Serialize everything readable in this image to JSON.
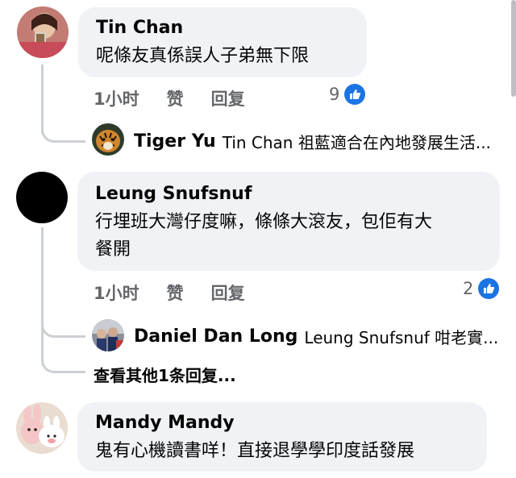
{
  "colors": {
    "bubble": "#f0f2f5",
    "like_blue": "#1b74e4",
    "meta_gray": "#65676b",
    "thread_line": "#ccd0d5"
  },
  "comments": [
    {
      "author": "Tin Chan",
      "text": "呢條友真係誤人子弟無下限",
      "time": "1小时",
      "like_action": "赞",
      "reply_action": "回复",
      "like_count": "9",
      "reply": {
        "author": "Tiger Yu",
        "text": "Tin Chan 祖藍適合在內地發展生活..."
      }
    },
    {
      "author": "Leung Snufsnuf",
      "text_line1": "行埋班大灣仔度嘛，條條大滾友，包佢有大",
      "text_line2": "餐開",
      "time": "1小时",
      "like_action": "赞",
      "reply_action": "回复",
      "like_count": "2",
      "reply": {
        "author": "Daniel Dan Long",
        "text": "Leung Snufsnuf 咁老實..."
      },
      "view_more": "查看其他1条回复..."
    },
    {
      "author": "Mandy Mandy",
      "text": "鬼有心機讀書咩！直接退學學印度話發展"
    }
  ]
}
